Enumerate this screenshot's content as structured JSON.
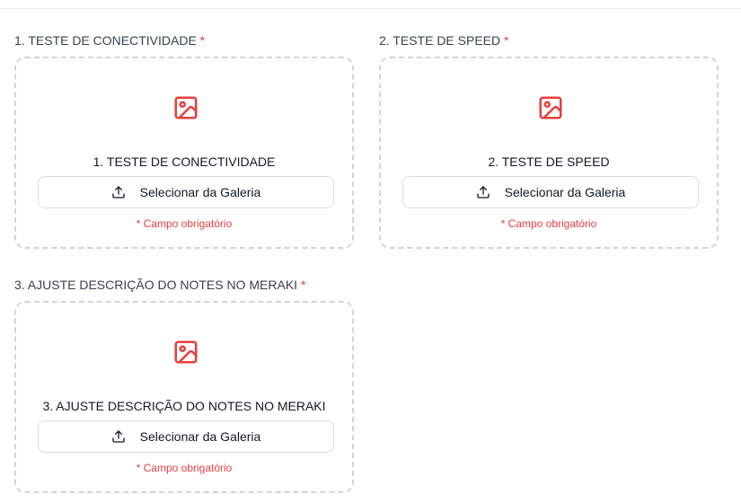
{
  "fields": [
    {
      "label": "1. TESTE DE CONECTIVIDADE",
      "required_marker": "*",
      "drop_title": "1. TESTE DE CONECTIVIDADE",
      "button_label": "Selecionar da Galeria",
      "required_note": "* Campo obrigatório",
      "icon": "image-icon",
      "button_icon": "upload-icon"
    },
    {
      "label": "2. TESTE DE SPEED",
      "required_marker": "*",
      "drop_title": "2. TESTE DE SPEED",
      "button_label": "Selecionar da Galeria",
      "required_note": "* Campo obrigatório",
      "icon": "image-icon",
      "button_icon": "upload-icon"
    },
    {
      "label": "3. AJUSTE DESCRIÇÃO DO NOTES NO MERAKI",
      "required_marker": "*",
      "drop_title": "3. AJUSTE DESCRIÇÃO DO NOTES NO MERAKI",
      "button_label": "Selecionar da Galeria",
      "required_note": "* Campo obrigatório",
      "icon": "image-icon",
      "button_icon": "upload-icon"
    }
  ],
  "colors": {
    "accent_red": "#e53e3e",
    "border_dashed": "#d1d5db",
    "text": "#111827"
  }
}
